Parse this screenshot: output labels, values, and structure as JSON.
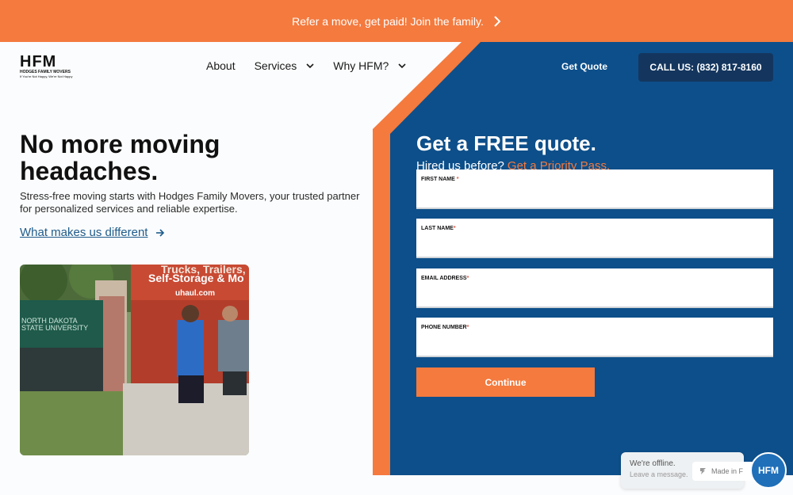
{
  "promo": {
    "text": "Refer a move, get paid! Join the family."
  },
  "logo": {
    "mark": "HFM",
    "name": "HODGES FAMILY MOVERS",
    "tagline": "If You're Not Happy, We're Not Happy"
  },
  "nav": {
    "items": [
      {
        "label": "About",
        "has_dropdown": false
      },
      {
        "label": "Services",
        "has_dropdown": true
      },
      {
        "label": "Why HFM?",
        "has_dropdown": true
      }
    ]
  },
  "header": {
    "get_quote": "Get Quote",
    "call_label": "CALL US: (832) 817-8160"
  },
  "hero": {
    "title": "No more moving headaches.",
    "description": "Stress-free moving starts with Hodges Family Movers, your trusted partner for personalized services and reliable expertise.",
    "link": "What makes us different"
  },
  "photo": {
    "sign_text_1": "NORTH DAKOTA",
    "sign_text_2": "STATE UNIVERSITY",
    "truck_text_1": "Trucks, Trailers,",
    "truck_text_2": "Self-Storage & Mo",
    "truck_url": "uhaul.com"
  },
  "form": {
    "title": "Get a FREE quote.",
    "subtitle": "Hired us before?",
    "subtitle_link": "Get a Priority Pass.",
    "fields": [
      {
        "label": "FIRST NAME",
        "required": "*"
      },
      {
        "label": "LAST NAME",
        "required": "*"
      },
      {
        "label": "EMAIL ADDRESS",
        "required": "*"
      },
      {
        "label": "PHONE NUMBER",
        "required": "*"
      }
    ],
    "submit": "Continue"
  },
  "chat": {
    "status": "We're offline.",
    "prompt": "Leave a message.",
    "made_in": "Made in F",
    "avatar": "HFM"
  },
  "colors": {
    "orange": "#f47a3e",
    "navy": "#0d4f8a",
    "dark_navy": "#14365e",
    "link_blue": "#1e5b8a"
  }
}
